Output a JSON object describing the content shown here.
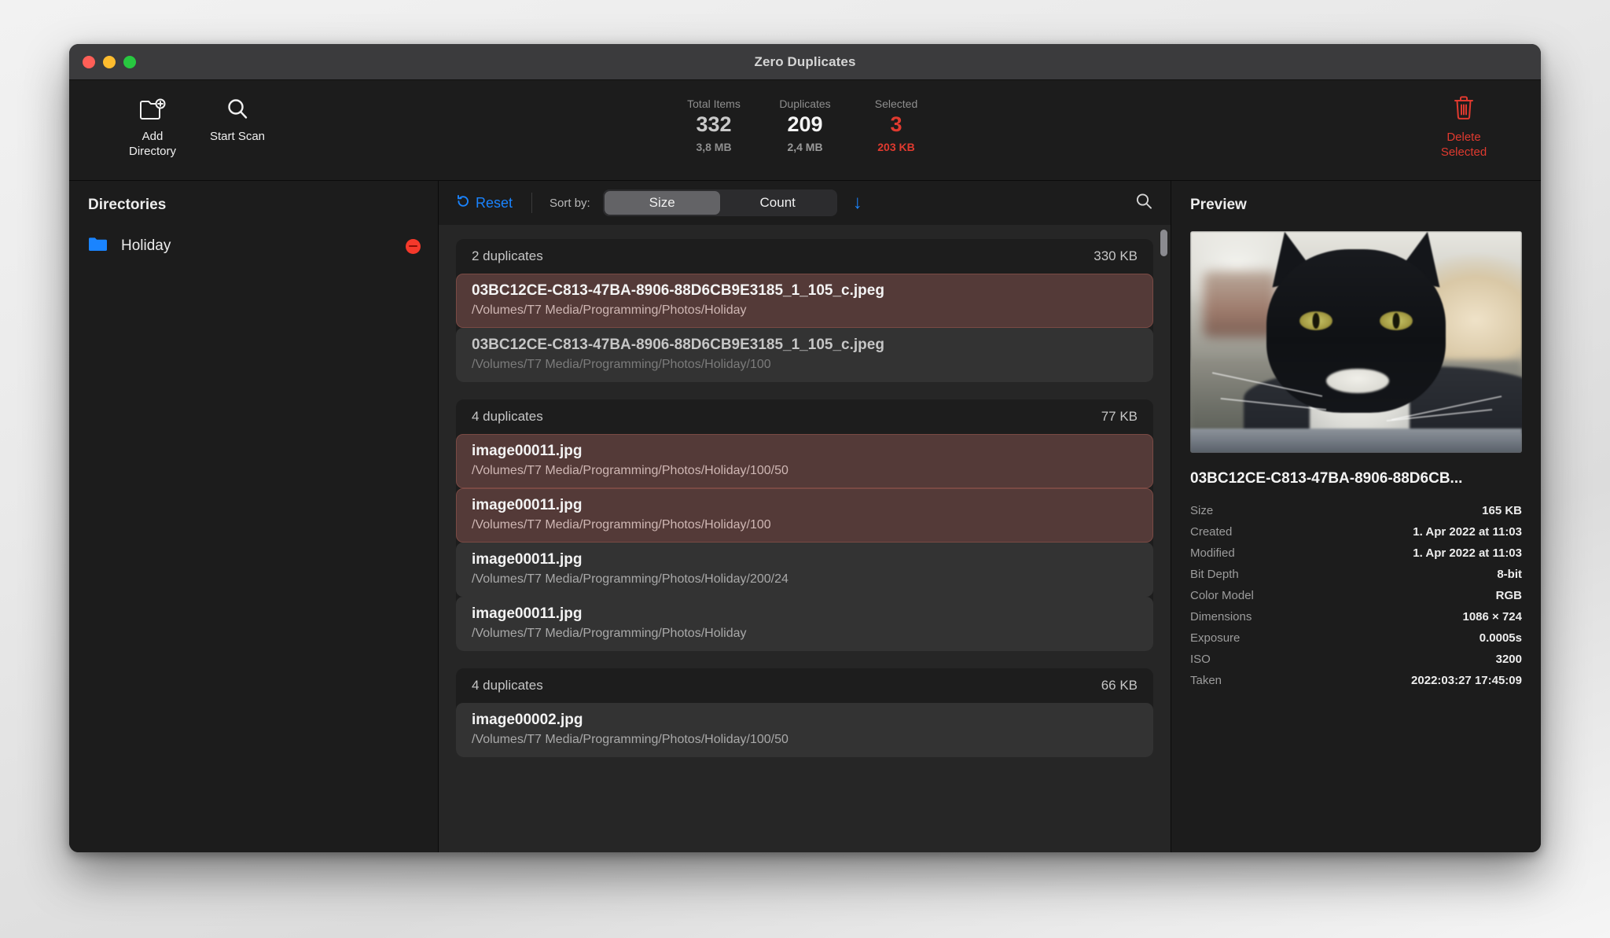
{
  "window": {
    "title": "Zero Duplicates"
  },
  "toolbar": {
    "add_directory_label": "Add\nDirectory",
    "start_scan_label": "Start Scan",
    "delete_selected_label": "Delete\nSelected",
    "stats": [
      {
        "label": "Total Items",
        "value": "332",
        "sub": "3,8 MB",
        "tone": "muted"
      },
      {
        "label": "Duplicates",
        "value": "209",
        "sub": "2,4 MB",
        "tone": "normal"
      },
      {
        "label": "Selected",
        "value": "3",
        "sub": "203 KB",
        "tone": "danger"
      }
    ]
  },
  "sidebar": {
    "title": "Directories",
    "items": [
      {
        "name": "Holiday"
      }
    ]
  },
  "sortbar": {
    "reset_label": "Reset",
    "sort_by_label": "Sort by:",
    "segments": [
      {
        "label": "Size",
        "active": true
      },
      {
        "label": "Count",
        "active": false
      }
    ],
    "sort_direction_glyph": "↓"
  },
  "groups": [
    {
      "count_label": "2 duplicates",
      "size_label": "330 KB",
      "files": [
        {
          "name": "03BC12CE-C813-47BA-8906-88D6CB9E3185_1_105_c.jpeg",
          "path": "/Volumes/T7 Media/Programming/Photos/Holiday",
          "state": "selected"
        },
        {
          "name": "03BC12CE-C813-47BA-8906-88D6CB9E3185_1_105_c.jpeg",
          "path": "/Volumes/T7 Media/Programming/Photos/Holiday/100",
          "state": "dim"
        }
      ]
    },
    {
      "count_label": "4 duplicates",
      "size_label": "77 KB",
      "files": [
        {
          "name": "image00011.jpg",
          "path": "/Volumes/T7 Media/Programming/Photos/Holiday/100/50",
          "state": "selected"
        },
        {
          "name": "image00011.jpg",
          "path": "/Volumes/T7 Media/Programming/Photos/Holiday/100",
          "state": "selected"
        },
        {
          "name": "image00011.jpg",
          "path": "/Volumes/T7 Media/Programming/Photos/Holiday/200/24",
          "state": "plain"
        },
        {
          "name": "image00011.jpg",
          "path": "/Volumes/T7 Media/Programming/Photos/Holiday",
          "state": "plain"
        }
      ]
    },
    {
      "count_label": "4 duplicates",
      "size_label": "66 KB",
      "files": [
        {
          "name": "image00002.jpg",
          "path": "/Volumes/T7 Media/Programming/Photos/Holiday/100/50",
          "state": "plain"
        }
      ]
    }
  ],
  "preview": {
    "title": "Preview",
    "filename": "03BC12CE-C813-47BA-8906-88D6CB...",
    "image_alt": "close-up photo of a black and white tuxedo cat",
    "metadata": [
      {
        "key": "Size",
        "value": "165 KB"
      },
      {
        "key": "Created",
        "value": "1. Apr 2022 at 11:03"
      },
      {
        "key": "Modified",
        "value": "1. Apr 2022 at 11:03"
      },
      {
        "key": "Bit Depth",
        "value": "8-bit"
      },
      {
        "key": "Color Model",
        "value": "RGB"
      },
      {
        "key": "Dimensions",
        "value": "1086 × 724"
      },
      {
        "key": "Exposure",
        "value": "0.0005s"
      },
      {
        "key": "ISO",
        "value": "3200"
      },
      {
        "key": "Taken",
        "value": "2022:03:27 17:45:09"
      }
    ]
  },
  "colors": {
    "accent_blue": "#1a84ff",
    "danger_red": "#e03a2f",
    "selected_row": "#543a38",
    "window_bg": "#1c1c1c",
    "list_bg": "#262626"
  }
}
